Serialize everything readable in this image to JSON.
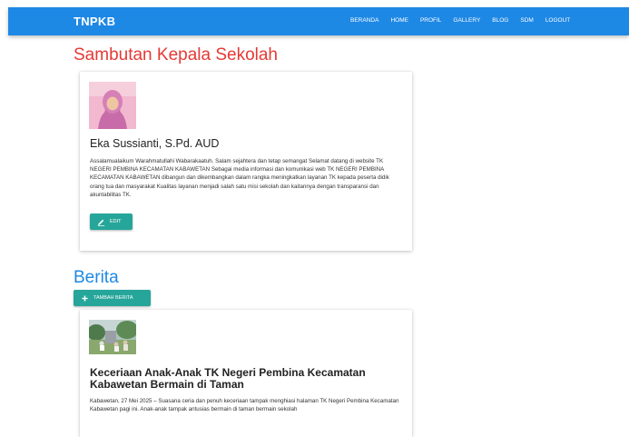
{
  "navbar": {
    "brand": "TNPKB",
    "links": [
      "BERANDA",
      "HOME",
      "PROFIL",
      "GALLERY",
      "BLOG",
      "SDM",
      "LOGOUT"
    ]
  },
  "welcome": {
    "title": "Sambutan Kepala Sekolah",
    "name": "Eka Sussianti, S.Pd. AUD",
    "text": "Assalamualaikum Warahmatullahi Wabarakaatuh. Salam sejahtera dan tetap semangat Selamat datang di website TK NEGERI PEMBINA KECAMATAN KABAWETAN Sebagai media informasi dan komunikasi web TK NEGERI PEMBINA KECAMATAN KABAWETAN dibangun dan dikembangkan dalam rangka meningkatkan layanan TK kepada peserta didik orang tua dan masyarakat Kualitas layanan menjadi salah satu misi sekolah dan kaitannya dengan transparansi dan akuntabilitas TK.",
    "edit_label": "EDIT"
  },
  "news": {
    "title": "Berita",
    "add_label": "TAMBAH BERITA",
    "items": [
      {
        "title": "Keceriaan Anak-Anak TK Negeri Pembina Kecamatan Kabawetan Bermain di Taman",
        "text": "Kabawetan, 27 Mei 2025 – Suasana ceria dan penuh keceriaan tampak menghiasi halaman TK Negeri Pembina Kecamatan Kabawetan pagi ini. Anak-anak tampak antusias bermain di taman bermain sekolah"
      }
    ]
  },
  "colors": {
    "navbar": "#1e88e5",
    "welcome_title": "#e53935",
    "news_title": "#1e88e5",
    "button": "#26a69a"
  },
  "icons": {
    "edit": "pencil-icon",
    "add": "plus-icon"
  }
}
